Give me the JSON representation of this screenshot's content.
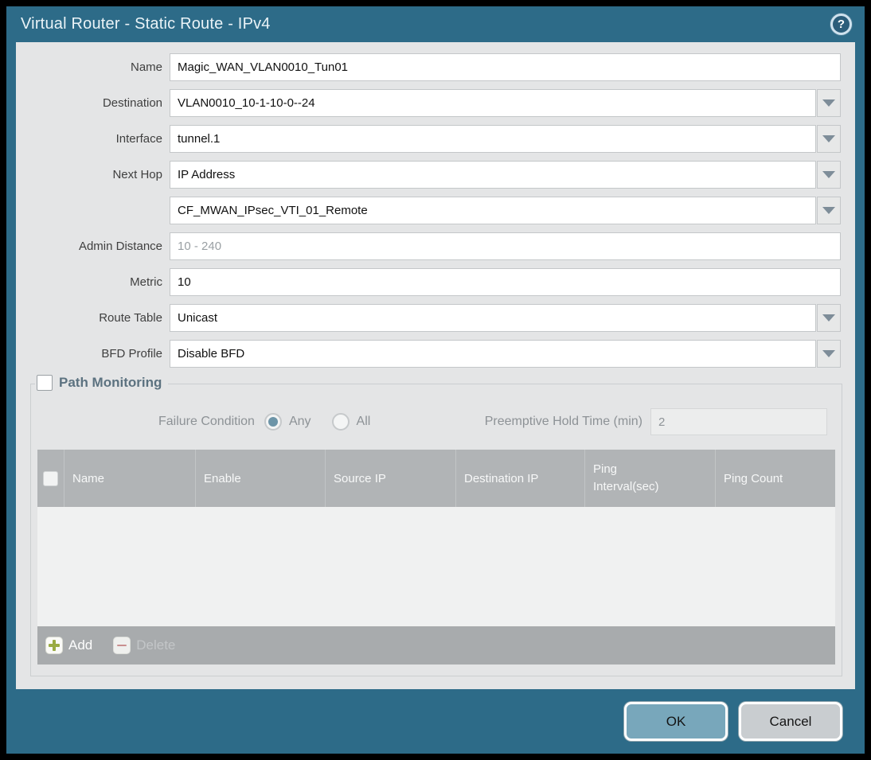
{
  "titlebar": {
    "title": "Virtual Router - Static Route - IPv4"
  },
  "form": {
    "fields": [
      {
        "label": "Name",
        "value": "Magic_WAN_VLAN0010_Tun01"
      },
      {
        "label": "Destination",
        "value": "VLAN0010_10-1-10-0--24"
      },
      {
        "label": "Interface",
        "value": "tunnel.1"
      },
      {
        "label": "Next Hop",
        "value": "IP Address"
      },
      {
        "label": "",
        "value": "CF_MWAN_IPsec_VTI_01_Remote"
      },
      {
        "label": "Admin Distance",
        "value": "",
        "placeholder": "10 - 240"
      },
      {
        "label": "Metric",
        "value": "10"
      },
      {
        "label": "Route Table",
        "value": "Unicast"
      },
      {
        "label": "BFD Profile",
        "value": "Disable BFD"
      }
    ]
  },
  "path_monitoring": {
    "title": "Path Monitoring",
    "checkbox_checked": false,
    "failure_condition": {
      "label": "Failure Condition",
      "options": [
        {
          "label": "Any",
          "selected": true
        },
        {
          "label": "All",
          "selected": false
        }
      ]
    },
    "preemptive_hold_time": {
      "label": "Preemptive Hold Time (min)",
      "value": "2"
    },
    "table": {
      "columns": [
        "Name",
        "Enable",
        "Source IP",
        "Destination IP",
        "Ping Interval(sec)",
        "Ping Count"
      ],
      "rows": []
    },
    "toolbar": {
      "add_label": "Add",
      "delete_label": "Delete",
      "delete_enabled": false
    }
  },
  "footer": {
    "ok_label": "OK",
    "cancel_label": "Cancel"
  },
  "colors": {
    "titlebar_teal": "#2d6b88",
    "panel_gray": "#e4e5e6",
    "table_header_gray": "#b1b4b6",
    "toolbar_gray": "#a8abad",
    "ok_button": "#78a7bb",
    "cancel_button": "#c9cdd0",
    "add_icon_green": "#9aab43",
    "delete_icon_red": "#c98f8f",
    "radio_selected": "#6d95a8"
  }
}
